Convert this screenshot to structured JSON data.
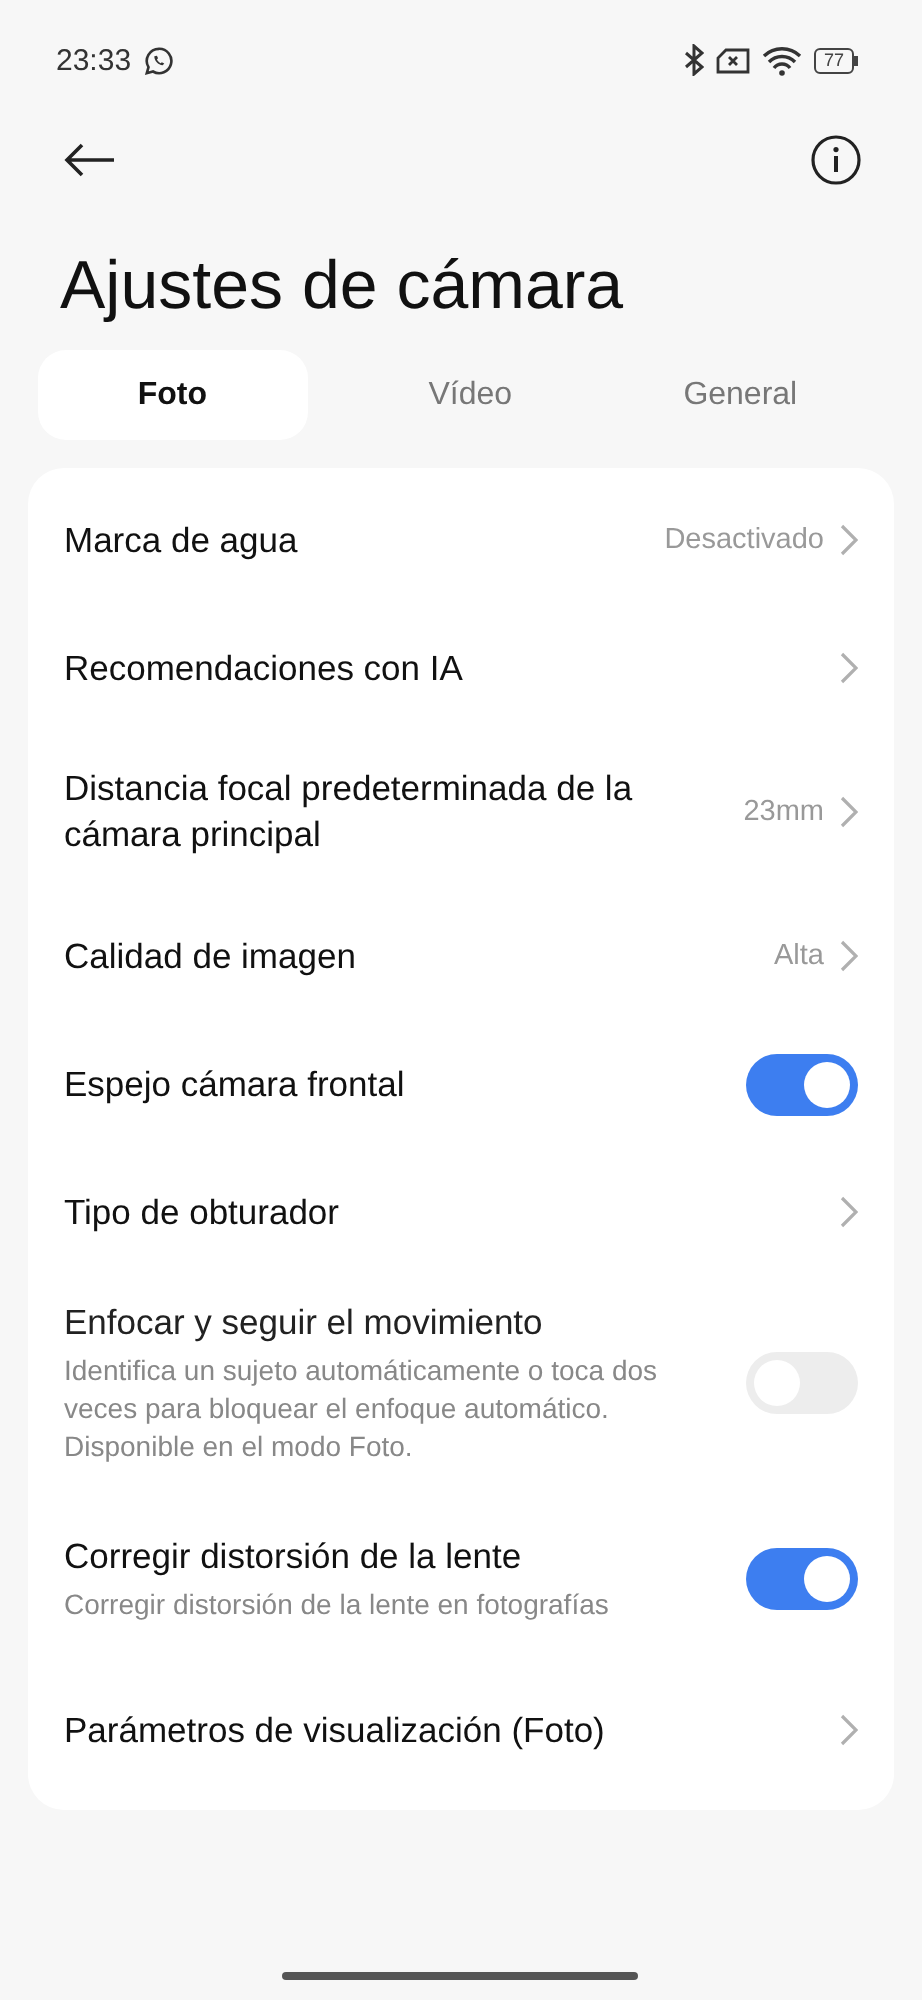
{
  "status_bar": {
    "time": "23:33",
    "battery": "77"
  },
  "title": "Ajustes de cámara",
  "tabs": [
    {
      "label": "Foto",
      "selected": true
    },
    {
      "label": "Vídeo",
      "selected": false
    },
    {
      "label": "General",
      "selected": false
    }
  ],
  "settings": [
    {
      "kind": "nav",
      "label": "Marca de agua",
      "value": "Desactivado"
    },
    {
      "kind": "nav",
      "label": "Recomendaciones con IA"
    },
    {
      "kind": "nav",
      "label": "Distancia focal predeterminada de la cámara principal",
      "value": "23mm"
    },
    {
      "kind": "nav",
      "label": "Calidad de imagen",
      "value": "Alta"
    },
    {
      "kind": "toggle",
      "label": "Espejo cámara frontal",
      "on": true,
      "disabled": false
    },
    {
      "kind": "nav",
      "label": "Tipo de obturador"
    },
    {
      "kind": "toggle",
      "label": "Enfocar y seguir el movimiento",
      "description": "Identifica un sujeto automáticamente o toca dos veces para bloquear el enfoque automático. Disponible en el modo Foto.",
      "on": false,
      "disabled": true
    },
    {
      "kind": "toggle",
      "label": "Corregir distorsión de la lente",
      "description": "Corregir distorsión de la lente en fotografías",
      "on": true,
      "disabled": false
    },
    {
      "kind": "nav",
      "label": "Parámetros de visualización (Foto)"
    }
  ]
}
